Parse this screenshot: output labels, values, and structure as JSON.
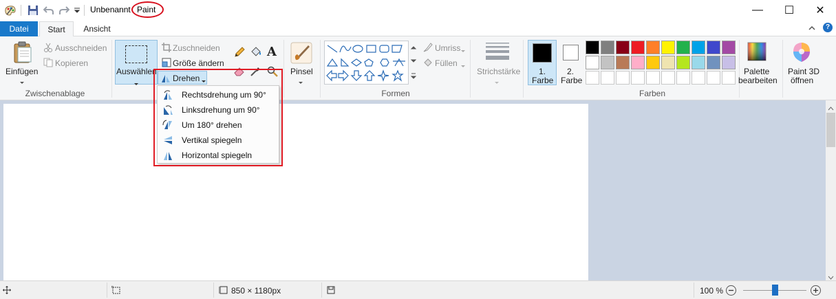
{
  "window": {
    "doc_name": "Unbenannt",
    "app_name": "Paint",
    "minimize_icon": "—",
    "maximize_icon": "☐",
    "close_icon": "✕"
  },
  "tabs": {
    "file": "Datei",
    "home": "Start",
    "view": "Ansicht"
  },
  "clipboard": {
    "paste": "Einfügen",
    "cut": "Ausschneiden",
    "copy": "Kopieren",
    "group": "Zwischenablage"
  },
  "image": {
    "select": "Auswählen",
    "crop": "Zuschneiden",
    "resize": "Größe ändern",
    "rotate": "Drehen"
  },
  "tools": {
    "brushes": "Pinsel"
  },
  "shapes": {
    "outline": "Umriss",
    "fill": "Füllen",
    "group": "Formen"
  },
  "size": {
    "label": "Strichstärke"
  },
  "colors": {
    "color1_line1": "1.",
    "color1_line2": "Farbe",
    "color2_line1": "2.",
    "color2_line2": "Farbe",
    "edit_line1": "Palette",
    "edit_line2": "bearbeiten",
    "group": "Farben",
    "palette_row1": [
      "#000000",
      "#7f7f7f",
      "#880015",
      "#ed1c24",
      "#ff7f27",
      "#fff200",
      "#22b14c",
      "#00a2e8",
      "#3f48cc",
      "#a349a4"
    ],
    "palette_row2": [
      "#ffffff",
      "#c3c3c3",
      "#b97a57",
      "#ffaec9",
      "#ffc90e",
      "#efe4b0",
      "#b5e61d",
      "#99d9ea",
      "#7092be",
      "#c8bfe7"
    ],
    "primary": "#000000",
    "secondary": "#ffffff"
  },
  "paint3d": {
    "line1": "Paint 3D",
    "line2": "öffnen"
  },
  "rotate_menu": {
    "items": [
      "Rechtsdrehung um 90°",
      "Linksdrehung um 90°",
      "Um 180° drehen",
      "Vertikal spiegeln",
      "Horizontal spiegeln"
    ]
  },
  "status": {
    "dimensions": "850 × 1180px",
    "zoom": "100 %",
    "zoom_level": 1.0
  }
}
